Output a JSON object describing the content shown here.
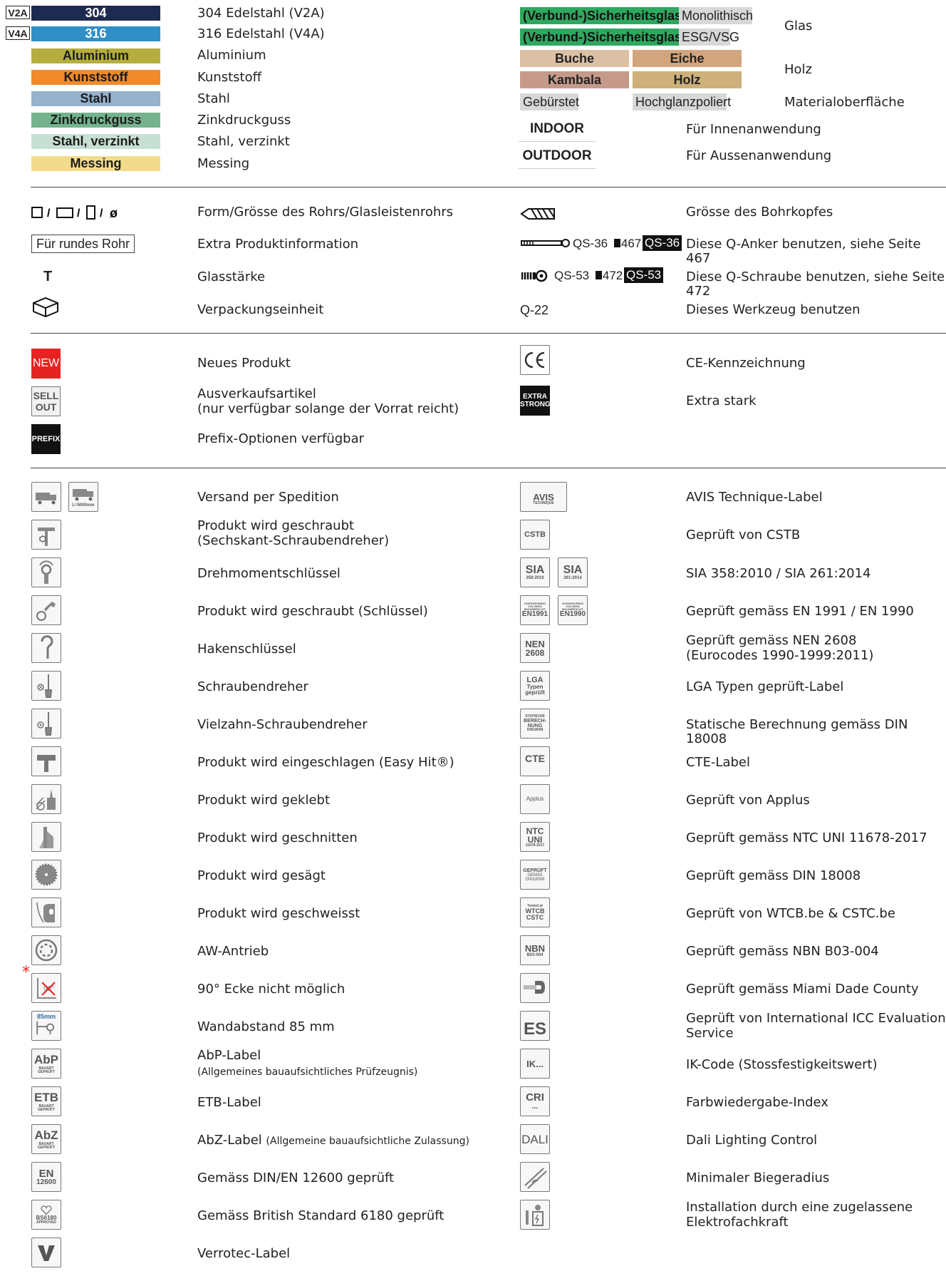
{
  "materials": [
    {
      "badge": "V2A",
      "label": "304",
      "desc": "304 Edelstahl (V2A)",
      "bg": "#1e2a4f",
      "fg": "#ffffff"
    },
    {
      "badge": "V4A",
      "label": "316",
      "desc": "316 Edelstahl (V4A)",
      "bg": "#2f8fc6",
      "fg": "#ffffff"
    },
    {
      "badge": "",
      "label": "Aluminium",
      "desc": "Aluminium",
      "bg": "#b5ae3e",
      "fg": "#1b1b1b"
    },
    {
      "badge": "",
      "label": "Kunststoff",
      "desc": "Kunststoff",
      "bg": "#f08a2a",
      "fg": "#1b1b1b"
    },
    {
      "badge": "",
      "label": "Stahl",
      "desc": "Stahl",
      "bg": "#96b2cd",
      "fg": "#1b1b1b"
    },
    {
      "badge": "",
      "label": "Zinkdruckguss",
      "desc": "Zinkdruckguss",
      "bg": "#74b38e",
      "fg": "#1b1b1b"
    },
    {
      "badge": "",
      "label": "Stahl, verzinkt",
      "desc": "Stahl, verzinkt",
      "bg": "#c8e0d4",
      "fg": "#1b1b1b"
    },
    {
      "badge": "",
      "label": "Messing",
      "desc": "Messing",
      "bg": "#f2dc8c",
      "fg": "#1b1b1b"
    }
  ],
  "glass": {
    "label1": "(Verbund-)Sicherheitsglas",
    "sub1": "Monolithisch",
    "label2": "(Verbund-)Sicherheitsglas",
    "sub2": "ESG/VSG",
    "desc": "Glas"
  },
  "wood": {
    "beech": "Buche",
    "oak": "Eiche",
    "kambala": "Kambala",
    "wood": "Holz",
    "desc": "Holz"
  },
  "surface": {
    "brushed": "Gebürstet",
    "polished": "Hochglanzpoliert",
    "desc": "Materialoberfläche"
  },
  "use": {
    "indoor": "INDOOR",
    "indoor_desc": "Für Innenanwendung",
    "outdoor": "OUTDOOR",
    "outdoor_desc": "Für Aussenanwendung"
  },
  "section2_left": [
    {
      "icon": "shape-size-icons",
      "desc": "Form/Grösse des Rohrs/Glasleistenrohrs"
    },
    {
      "icon": "Für rundes Rohr",
      "desc": "Extra Produktinformation"
    },
    {
      "icon": "T",
      "desc": "Glasstärke"
    },
    {
      "icon": "box-icon",
      "desc": "Verpackungseinheit"
    }
  ],
  "section2_right": [
    {
      "icon": "drill-bit-icon",
      "code": "",
      "desc": "Grösse des Bohrkopfes"
    },
    {
      "icon": "anchor-icon",
      "code": "QS-36",
      "page": "467",
      "tag": "QS-36",
      "desc": "Diese Q-Anker benutzen, siehe Seite 467"
    },
    {
      "icon": "screw-icon",
      "code": "QS-53",
      "page": "472",
      "tag": "QS-53",
      "desc": "Diese Q-Schraube benutzen, siehe Seite 472"
    },
    {
      "icon": "",
      "code": "Q-22",
      "desc": "Dieses Werkzeug benutzen"
    }
  ],
  "section3": {
    "new_badge": "NEW",
    "new_desc": "Neues Produkt",
    "sellout_badge1": "SELL",
    "sellout_badge2": "OUT",
    "sellout_desc1": "Ausverkaufsartikel",
    "sellout_desc2": "(nur verfügbar solange der Vorrat reicht)",
    "prefix_badge": "PREFIX",
    "prefix_desc": "Prefix-Optionen verfügbar",
    "ce_desc": "CE-Kennzeichnung",
    "extra_badge1": "EXTRA",
    "extra_badge2": "STRONG",
    "extra_desc": "Extra stark"
  },
  "left_icons": [
    {
      "desc": "Versand per Spedition"
    },
    {
      "desc": "Produkt wird geschraubt",
      "desc2": "(Sechskant-Schraubendreher)"
    },
    {
      "desc": "Drehmomentschlüssel"
    },
    {
      "desc": "Produkt wird geschraubt (Schlüssel)"
    },
    {
      "desc": "Hakenschlüssel"
    },
    {
      "desc": "Schraubendreher"
    },
    {
      "desc": "Vielzahn-Schraubendreher"
    },
    {
      "desc": "Produkt wird eingeschlagen (Easy Hit®)"
    },
    {
      "desc": "Produkt wird geklebt"
    },
    {
      "desc": "Produkt wird geschnitten"
    },
    {
      "desc": "Produkt wird gesägt"
    },
    {
      "desc": "Produkt wird geschweisst"
    },
    {
      "desc": "AW-Antrieb"
    },
    {
      "desc": "90° Ecke nicht möglich"
    },
    {
      "desc": "Wandabstand 85 mm"
    },
    {
      "desc": "AbP-Label",
      "desc2": "(Allgemeines bauaufsichtliches Prüfzeugnis)"
    },
    {
      "desc": "ETB-Label"
    },
    {
      "desc": "AbZ-Label",
      "desc_small": "(Allgemeine bauaufsichtliche Zulassung)"
    },
    {
      "desc": "Gemäss DIN/EN 12600 geprüft"
    },
    {
      "desc": "Gemäss British Standard 6180 geprüft"
    },
    {
      "desc": "Verrotec-Label"
    }
  ],
  "left_icon_texts": {
    "truck_size": "L=5000mm",
    "wall": "85mm",
    "abp": "AbP",
    "etb": "ETB",
    "abz": "AbZ",
    "bauart": "BAUART",
    "geprueft": "GEPRÜFT",
    "en": "EN",
    "en_num": "12600",
    "bs": "BS6180",
    "approved": "APPROVED"
  },
  "right_icons": [
    {
      "desc": "AVIS Technique-Label"
    },
    {
      "desc": "Geprüft von CSTB"
    },
    {
      "desc": "SIA 358:2010 / SIA 261:2014"
    },
    {
      "desc": "Geprüft gemäss EN 1991 / EN 1990"
    },
    {
      "desc": "Geprüft gemäss NEN 2608",
      "desc2": "(Eurocodes 1990-1999:2011)"
    },
    {
      "desc": "LGA Typen geprüft-Label"
    },
    {
      "desc": "Statische Berechnung gemäss DIN 18008"
    },
    {
      "desc": "CTE-Label"
    },
    {
      "desc": "Geprüft von Applus"
    },
    {
      "desc": "Geprüft gemäss NTC UNI 11678-2017"
    },
    {
      "desc": "Geprüft gemäss DIN 18008"
    },
    {
      "desc": "Geprüft von WTCB.be & CSTC.be"
    },
    {
      "desc": "Geprüft gemäss NBN B03-004"
    },
    {
      "desc": "Geprüft gemäss Miami Dade County"
    },
    {
      "desc": "Geprüft von International ICC Evaluation",
      "desc2": "Service"
    },
    {
      "desc": "IK-Code (Stossfestigkeitswert)"
    },
    {
      "desc": "Farbwiedergabe-Index"
    },
    {
      "desc": "Dali Lighting Control"
    },
    {
      "desc": "Minimaler Biegeradius"
    },
    {
      "desc": "Installation durch eine zugelassene",
      "desc2": "Elektrofachkraft"
    }
  ],
  "right_icon_texts": {
    "avis": "AVIS",
    "technique": "TECHNIQUE",
    "cstb": "CSTB",
    "sia": "SIA",
    "sia1": "358:2010",
    "sia2": "261:2014",
    "goed": "GOEDKEURING",
    "volgens": "VOLGENS",
    "bouw": "BOUWBESLUIT",
    "en1991": "EN1991",
    "en1990": "EN1990",
    "nen": "NEN",
    "nen_num": "2608",
    "lga": "LGA",
    "typen": "Typen",
    "gepr": "geprüft",
    "stat1": "STATISCHE",
    "stat2": "BERECH-",
    "stat3": "NUNG",
    "stat4": "DIN18008",
    "cte": "CTE",
    "applus": "Applus",
    "ntc": "NTC",
    "uni": "UNI",
    "uni_num": "11678-2017",
    "gepr2": "GEPRÜFT",
    "gemass": "GEMÄß",
    "din18008": "DIN18008",
    "tested": "Tested at",
    "wtcb": "WTCB",
    "cstc": "CSTC",
    "nbn": "NBN",
    "nbn_num": "B03-004",
    "es": "ES",
    "ik": "IK...",
    "cri": "CRI",
    "cri_dots": "...",
    "dali": "DALI"
  },
  "colors": {
    "glass_green": "#2fa85f",
    "glass_grey": "#d8d8d8",
    "beech": "#dcc0a6",
    "oak": "#d3a57e",
    "kambala": "#c59a8a",
    "holz": "#cdb07a",
    "new": "#e52421",
    "star": "#e52421"
  }
}
